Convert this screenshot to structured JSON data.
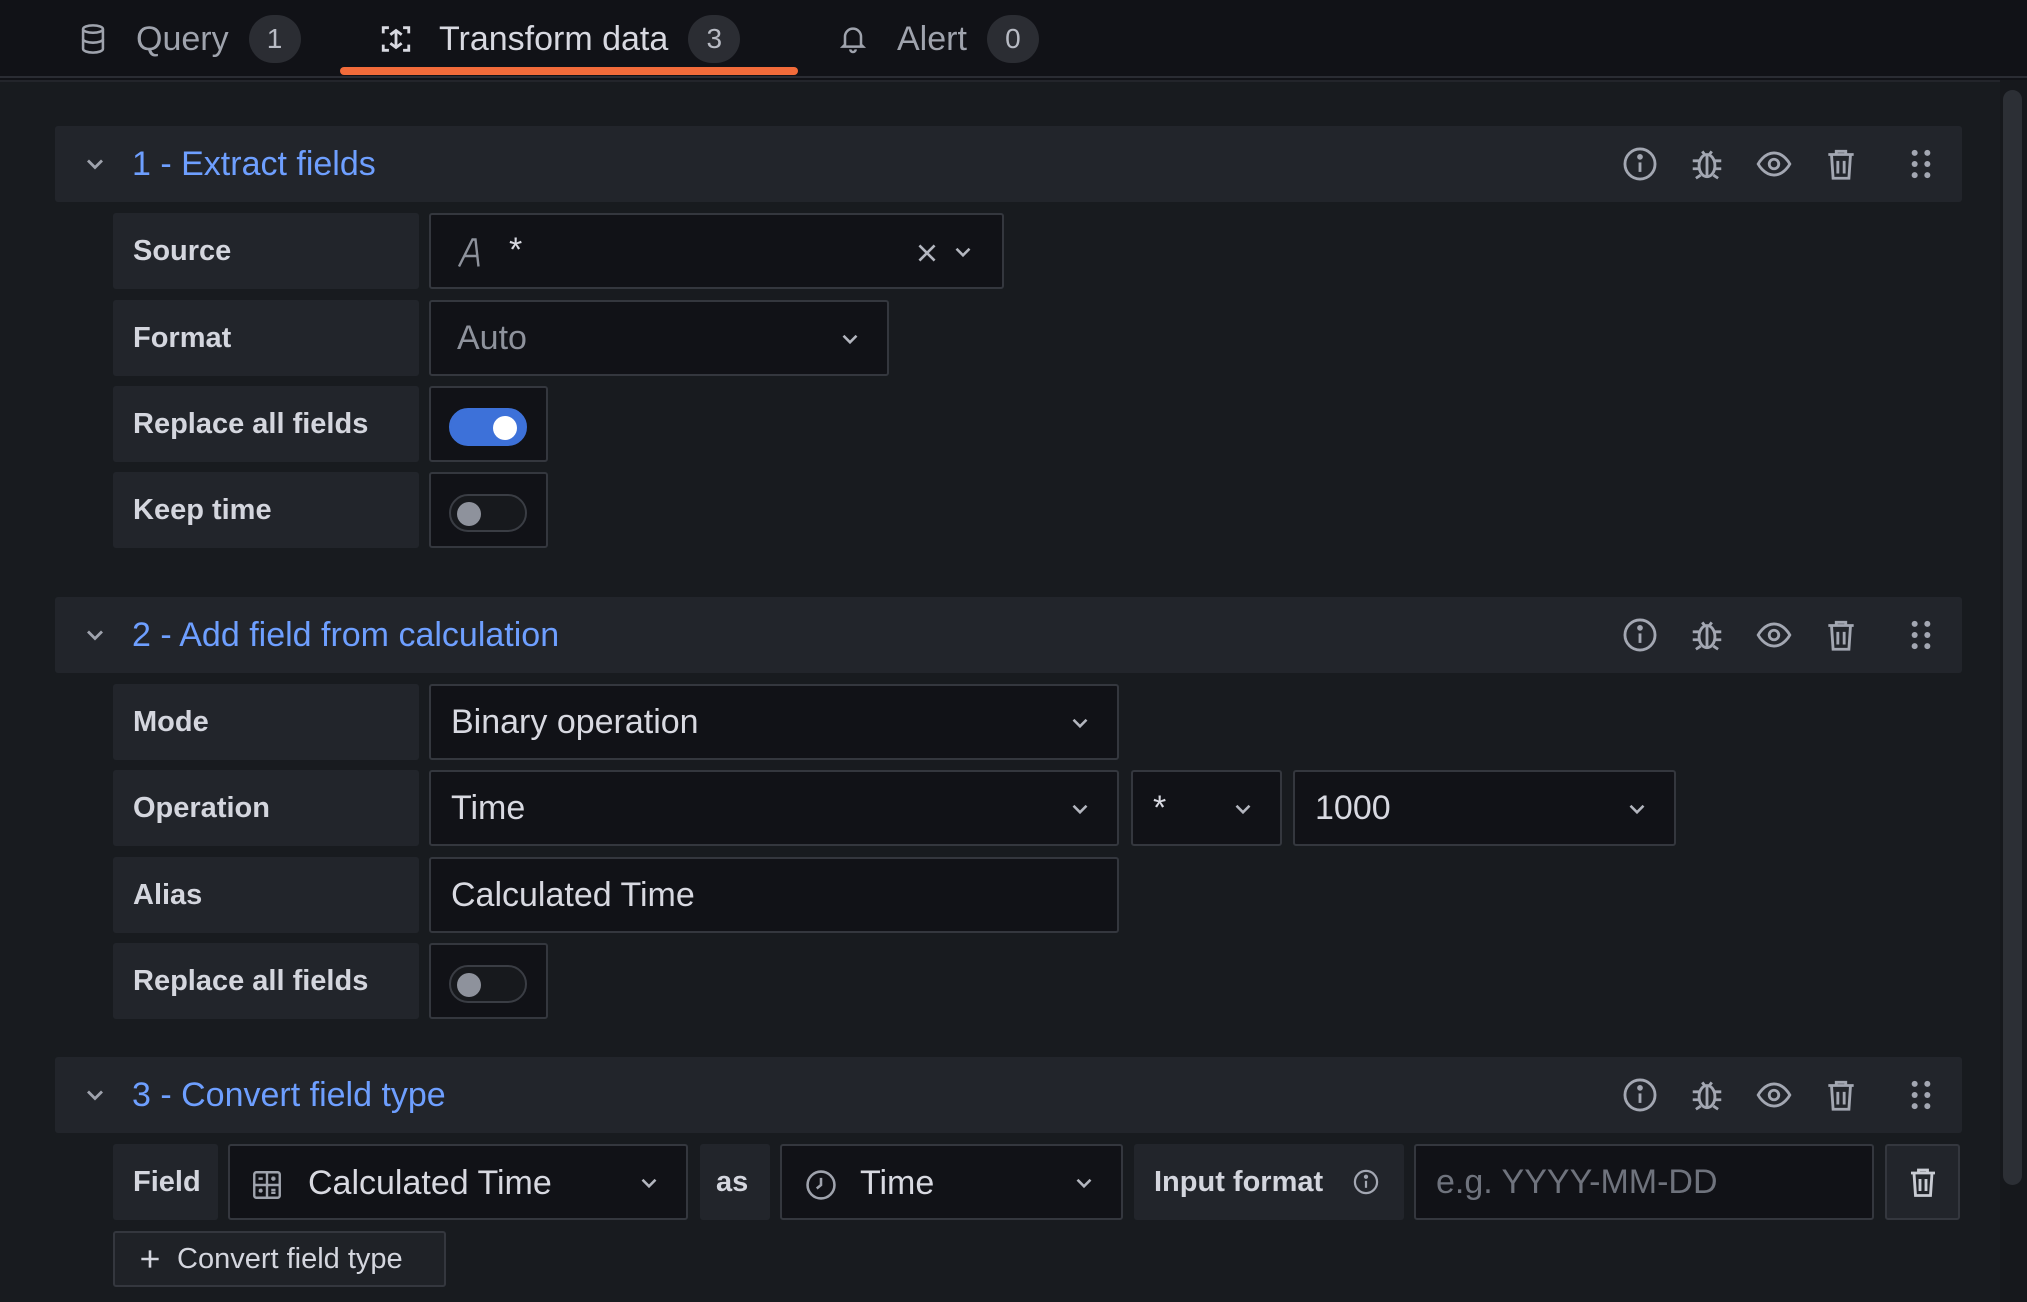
{
  "tabs": [
    {
      "label": "Query",
      "count": "1",
      "icon": "database-icon"
    },
    {
      "label": "Transform data",
      "count": "3",
      "icon": "transform-icon"
    },
    {
      "label": "Alert",
      "count": "0",
      "icon": "bell-icon"
    }
  ],
  "active_tab": "Transform data",
  "colors": {
    "accent": "#6e9fff",
    "tab_underline": "#f26b3a",
    "toggle_on": "#3d71d9"
  },
  "transformations": [
    {
      "title": "1 - Extract fields",
      "fields": {
        "source": {
          "label": "Source",
          "value": "*",
          "icon": "text-icon"
        },
        "format": {
          "label": "Format",
          "value": "Auto"
        },
        "replace_all": {
          "label": "Replace all fields",
          "on": true
        },
        "keep_time": {
          "label": "Keep time",
          "on": false
        }
      }
    },
    {
      "title": "2 - Add field from calculation",
      "fields": {
        "mode": {
          "label": "Mode",
          "value": "Binary operation"
        },
        "operation": {
          "label": "Operation",
          "left": "Time",
          "operator": "*",
          "right": "1000"
        },
        "alias": {
          "label": "Alias",
          "value": "Calculated Time"
        },
        "replace_all": {
          "label": "Replace all fields",
          "on": false
        }
      }
    },
    {
      "title": "3 - Convert field type",
      "fields": {
        "field": {
          "label": "Field",
          "value": "Calculated Time",
          "icon": "calculator-icon"
        },
        "as_label": "as",
        "type": {
          "value": "Time",
          "icon": "clock-icon"
        },
        "input_format": {
          "label": "Input format",
          "placeholder": "e.g. YYYY-MM-DD",
          "value": ""
        }
      },
      "add_button": "Convert field type"
    }
  ]
}
